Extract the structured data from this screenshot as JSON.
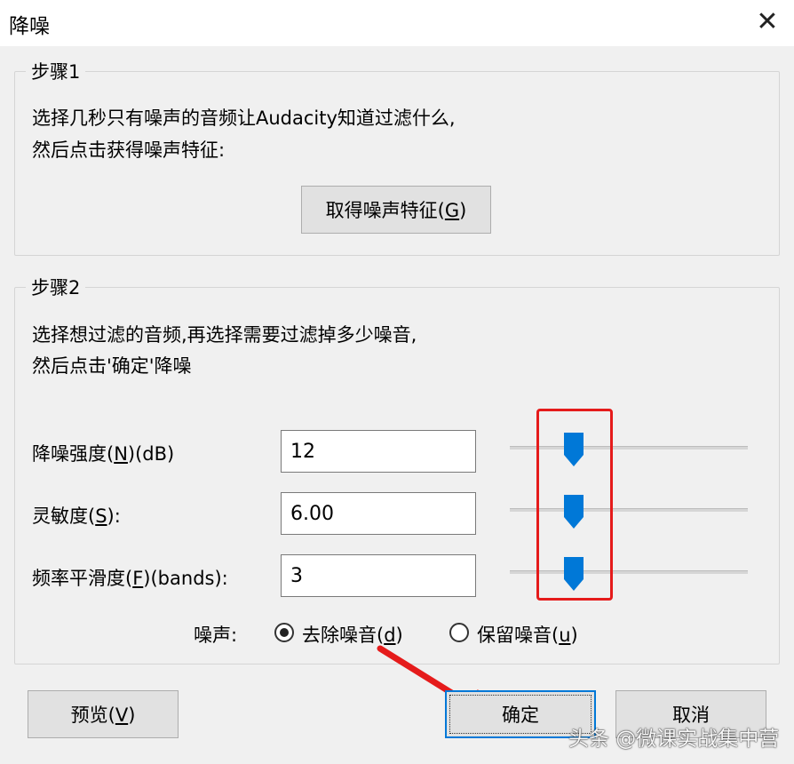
{
  "window": {
    "title": "降噪"
  },
  "step1": {
    "title": "步骤1",
    "line1": "选择几秒只有噪声的音频让Audacity知道过滤什么,",
    "line2": "然后点击获得噪声特征:",
    "button_label": "取得噪声特征",
    "button_mnemonic": "G"
  },
  "step2": {
    "title": "步骤2",
    "line1": "选择想过滤的音频,再选择需要过滤掉多少噪音,",
    "line2": "然后点击'确定'降噪",
    "fields": [
      {
        "label_prefix": "降噪强度(",
        "mnemonic": "N",
        "label_suffix": ")(dB)",
        "value": "12",
        "slider_level": 0.27
      },
      {
        "label_prefix": "灵敏度(",
        "mnemonic": "S",
        "label_suffix": "):",
        "value": "6.00",
        "slider_level": 0.27
      },
      {
        "label_prefix": "频率平滑度(",
        "mnemonic": "F",
        "label_suffix": ")(bands):",
        "value": "3",
        "slider_level": 0.27
      }
    ],
    "noise_label": "噪声:",
    "radio_remove": {
      "label_prefix": "去除噪音(",
      "mnemonic": "d",
      "label_suffix": ")",
      "checked": true
    },
    "radio_keep": {
      "label_prefix": "保留噪音(",
      "mnemonic": "u",
      "label_suffix": ")",
      "checked": false
    }
  },
  "footer": {
    "preview": {
      "prefix": "预览(",
      "mnemonic": "V",
      "suffix": ")"
    },
    "ok_label": "确定",
    "cancel_label": "取消"
  },
  "watermark": "头条 @微课实战集中营",
  "colors": {
    "highlight": "#e51b1b",
    "slider_thumb": "#0078d7"
  }
}
